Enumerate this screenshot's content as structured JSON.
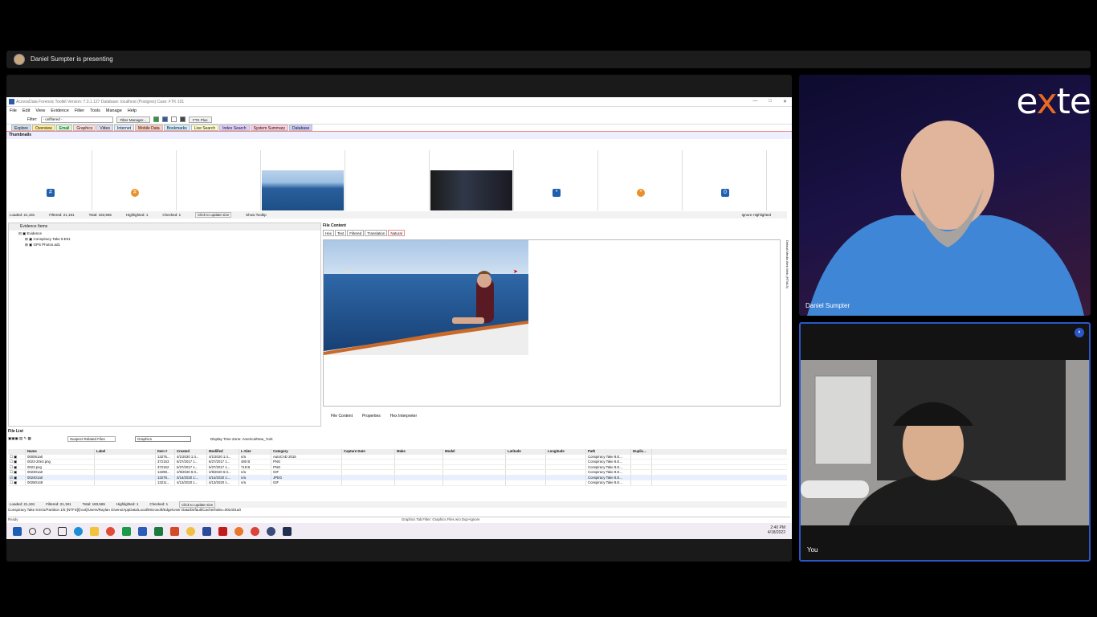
{
  "meeting": {
    "presenting_text": "Daniel Sumpter is presenting",
    "brand_text": "exte",
    "participants": [
      {
        "name": "Daniel Sumpter"
      },
      {
        "name": "You"
      }
    ]
  },
  "app": {
    "title": "AccessData Forensic Toolkit Version: 7.3.1.127 Database: localhost (Postgres) Case: FTK 101",
    "menu": [
      "File",
      "Edit",
      "View",
      "Evidence",
      "Filter",
      "Tools",
      "Manage",
      "Help"
    ],
    "filter_label": "Filter:",
    "filter_value": "- unfiltered -",
    "filter_manager": "Filter Manager...",
    "ftk_plus": "FTK Plus",
    "tabs": [
      "Explore",
      "Overview",
      "Email",
      "Graphics",
      "Video",
      "Internet",
      "Mobile Data",
      "Bookmarks",
      "Live Search",
      "Index Search",
      "System Summary",
      "Database"
    ],
    "thumbnails_title": "Thumbnails",
    "thumb_status": {
      "loaded": "Loaded: 21,191",
      "filtered": "Filtered: 21,191",
      "total": "Total: 183,565",
      "highlighted": "Highlighted: 1",
      "checked": "Checked: 1",
      "update": "Click to update size",
      "tooltip": "Show Tooltip",
      "ignore": "Ignore Highlighted"
    },
    "evidence_items_title": "Evidence Items",
    "tree": [
      "Evidence",
      "Conspiracy Take 8.E01",
      "GPS Photos.ad1"
    ],
    "file_content_title": "File Content",
    "fc_tabs": [
      "Hex",
      "Text",
      "Filtered",
      "Translation",
      "Natural"
    ],
    "vertical_tabs": "Default  Media  Web  Web (HTML5)",
    "bottom_tabs": [
      "File Content",
      "Properties",
      "Hex Interpreter"
    ],
    "file_list_title": "File List",
    "fl_filter": "Suspect Related Files",
    "fl_category": "Graphics",
    "timezone": "Display Time Zone: America/New_York",
    "columns": [
      "Name",
      "Label",
      "Item #",
      "Created",
      "Modified",
      "L-Size",
      "Capture Date",
      "Make",
      "Model",
      "Latitude",
      "Longitude",
      "Path",
      "Duplic..."
    ],
    "rows": [
      [
        "000061a0",
        "",
        "13275...",
        "4/1/2020 1:4...",
        "4/1/2020 1:4...",
        "n/a",
        "",
        "",
        "",
        "",
        "",
        "Conspiracy Take 8.E...",
        ""
      ],
      [
        "0023-20e3.png",
        "",
        "372153",
        "6/27/2017 1...",
        "6/27/2017 1...",
        "480 B",
        "",
        "",
        "",
        "",
        "",
        "Conspiracy Take 8.E...",
        ""
      ],
      [
        "0023.png",
        "",
        "372152",
        "6/27/2017 1...",
        "6/27/2017 1...",
        "719 B",
        "",
        "",
        "",
        "",
        "",
        "Conspiracy Take 8.E...",
        ""
      ],
      [
        "002301a0",
        "",
        "13298...",
        "4/9/2020 6:3...",
        "4/9/2020 6:3...",
        "n/a",
        "",
        "",
        "",
        "",
        "",
        "Conspiracy Take 8.E...",
        ""
      ],
      [
        "002401a0",
        "",
        "13278...",
        "4/14/2020 1:...",
        "4/14/2020 1:...",
        "n/a",
        "",
        "",
        "",
        "",
        "",
        "Conspiracy Take 8.E...",
        ""
      ],
      [
        "00260148",
        "",
        "13211...",
        "4/13/2020 1...",
        "4/13/2020 1...",
        "n/a",
        "",
        "",
        "",
        "",
        "",
        "Conspiracy Take 8.E...",
        ""
      ]
    ],
    "categories": [
      "AutoCAD 2015",
      "PNG",
      "PNG",
      "GIF",
      "JPEG",
      "GIF"
    ],
    "fl_status": {
      "loaded": "Loaded: 21,191",
      "filtered": "Filtered: 21,191",
      "total": "Total: 183,565",
      "highlighted": "Highlighted: 1",
      "checked": "Checked: 1",
      "update": "Click to update size"
    },
    "path": "Conspiracy Take 8.E01/Partition 1/5 [NTFS]/[root]/Users/Raylan Givens/AppData/Local/Microsoft/Edge/User Data/Default/Cache/index=002401a0",
    "ready": "Ready",
    "graphics_filter": "Graphics Tab Filter: Graphics Files w/o Dup+Ignore"
  },
  "taskbar": {
    "time": "2:40 PM",
    "date": "4/18/2022"
  },
  "colors": {
    "accent": "#2b57c9",
    "brand": "#e86a22"
  }
}
